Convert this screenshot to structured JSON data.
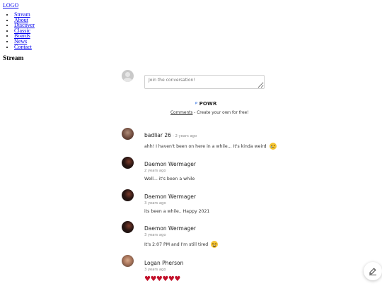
{
  "logo": {
    "alt": "LOGO"
  },
  "nav": {
    "items": [
      "Stream",
      "About",
      "Discover",
      "Classic",
      "Boards",
      "News",
      "Contact"
    ]
  },
  "page": {
    "title": "Stream"
  },
  "composer": {
    "placeholder": "Join the conversation!"
  },
  "powr": {
    "brand": "POWR",
    "link": "Comments",
    "tagline": " - Create your own for free!"
  },
  "comments": [
    {
      "author": "badliar 26",
      "time": "· 2 years ago",
      "text": "ahh! I haven't been on here in a while... It's kinda weird",
      "emoji": "crying-face"
    },
    {
      "author": "Daemon Wermager",
      "time": "2 years ago",
      "text": "Well... it's been a while"
    },
    {
      "author": "Daemon Wermager",
      "time": "3 years ago",
      "text": "its been a while.. Happy 2021"
    },
    {
      "author": "Daemon Wermager",
      "time": "3 years ago",
      "text": "It's 2:07 PM and I'm still tired",
      "emoji": "tired-face"
    },
    {
      "author": "Logan Pherson",
      "time": "3 years ago",
      "text": "♥♥♥♥♥♥"
    }
  ],
  "icons": {
    "fab": "edit-icon",
    "powr": "powr-logo-icon"
  },
  "colors": {
    "heart": "#c2102a",
    "powr_blue": "#2f6fe4"
  }
}
